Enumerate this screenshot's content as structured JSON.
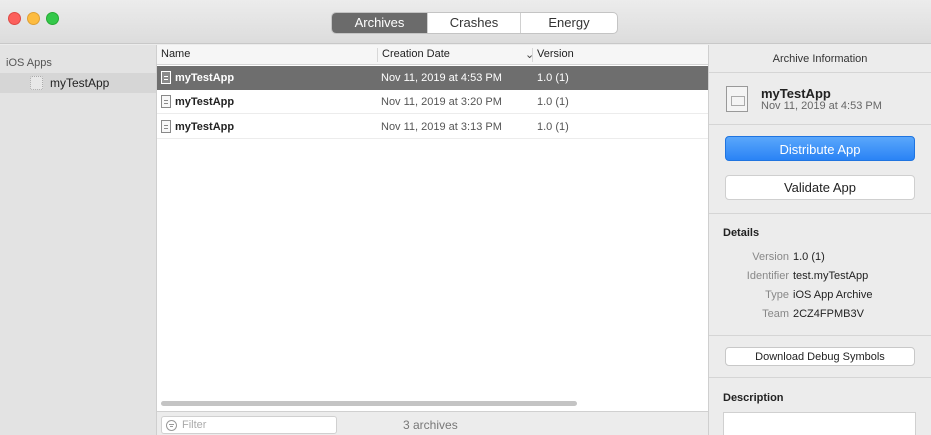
{
  "toolbar": {
    "tabs": [
      {
        "label": "Archives",
        "active": true
      },
      {
        "label": "Crashes",
        "active": false
      },
      {
        "label": "Energy",
        "active": false
      }
    ]
  },
  "sidebar": {
    "section_title": "iOS Apps",
    "items": [
      {
        "label": "myTestApp",
        "selected": true
      }
    ]
  },
  "archive_list": {
    "columns": {
      "name": "Name",
      "date": "Creation Date",
      "version": "Version"
    },
    "rows": [
      {
        "name": "myTestApp",
        "date": "Nov 11, 2019 at 4:53 PM",
        "version": "1.0 (1)",
        "selected": true
      },
      {
        "name": "myTestApp",
        "date": "Nov 11, 2019 at 3:20 PM",
        "version": "1.0 (1)",
        "selected": false
      },
      {
        "name": "myTestApp",
        "date": "Nov 11, 2019 at 3:13 PM",
        "version": "1.0 (1)",
        "selected": false
      }
    ],
    "filter_placeholder": "Filter",
    "count_label": "3 archives"
  },
  "inspector": {
    "header": "Archive Information",
    "app_name": "myTestApp",
    "app_date": "Nov 11, 2019 at 4:53 PM",
    "distribute_label": "Distribute App",
    "validate_label": "Validate App",
    "details_title": "Details",
    "details": {
      "version_key": "Version",
      "version_val": "1.0 (1)",
      "identifier_key": "Identifier",
      "identifier_val": "test.myTestApp",
      "type_key": "Type",
      "type_val": "iOS App Archive",
      "team_key": "Team",
      "team_val": "2CZ4FPMB3V"
    },
    "debug_label": "Download Debug Symbols",
    "description_title": "Description"
  },
  "colors": {
    "accent": "#2a83f5",
    "selection": "#6e6e6e"
  }
}
